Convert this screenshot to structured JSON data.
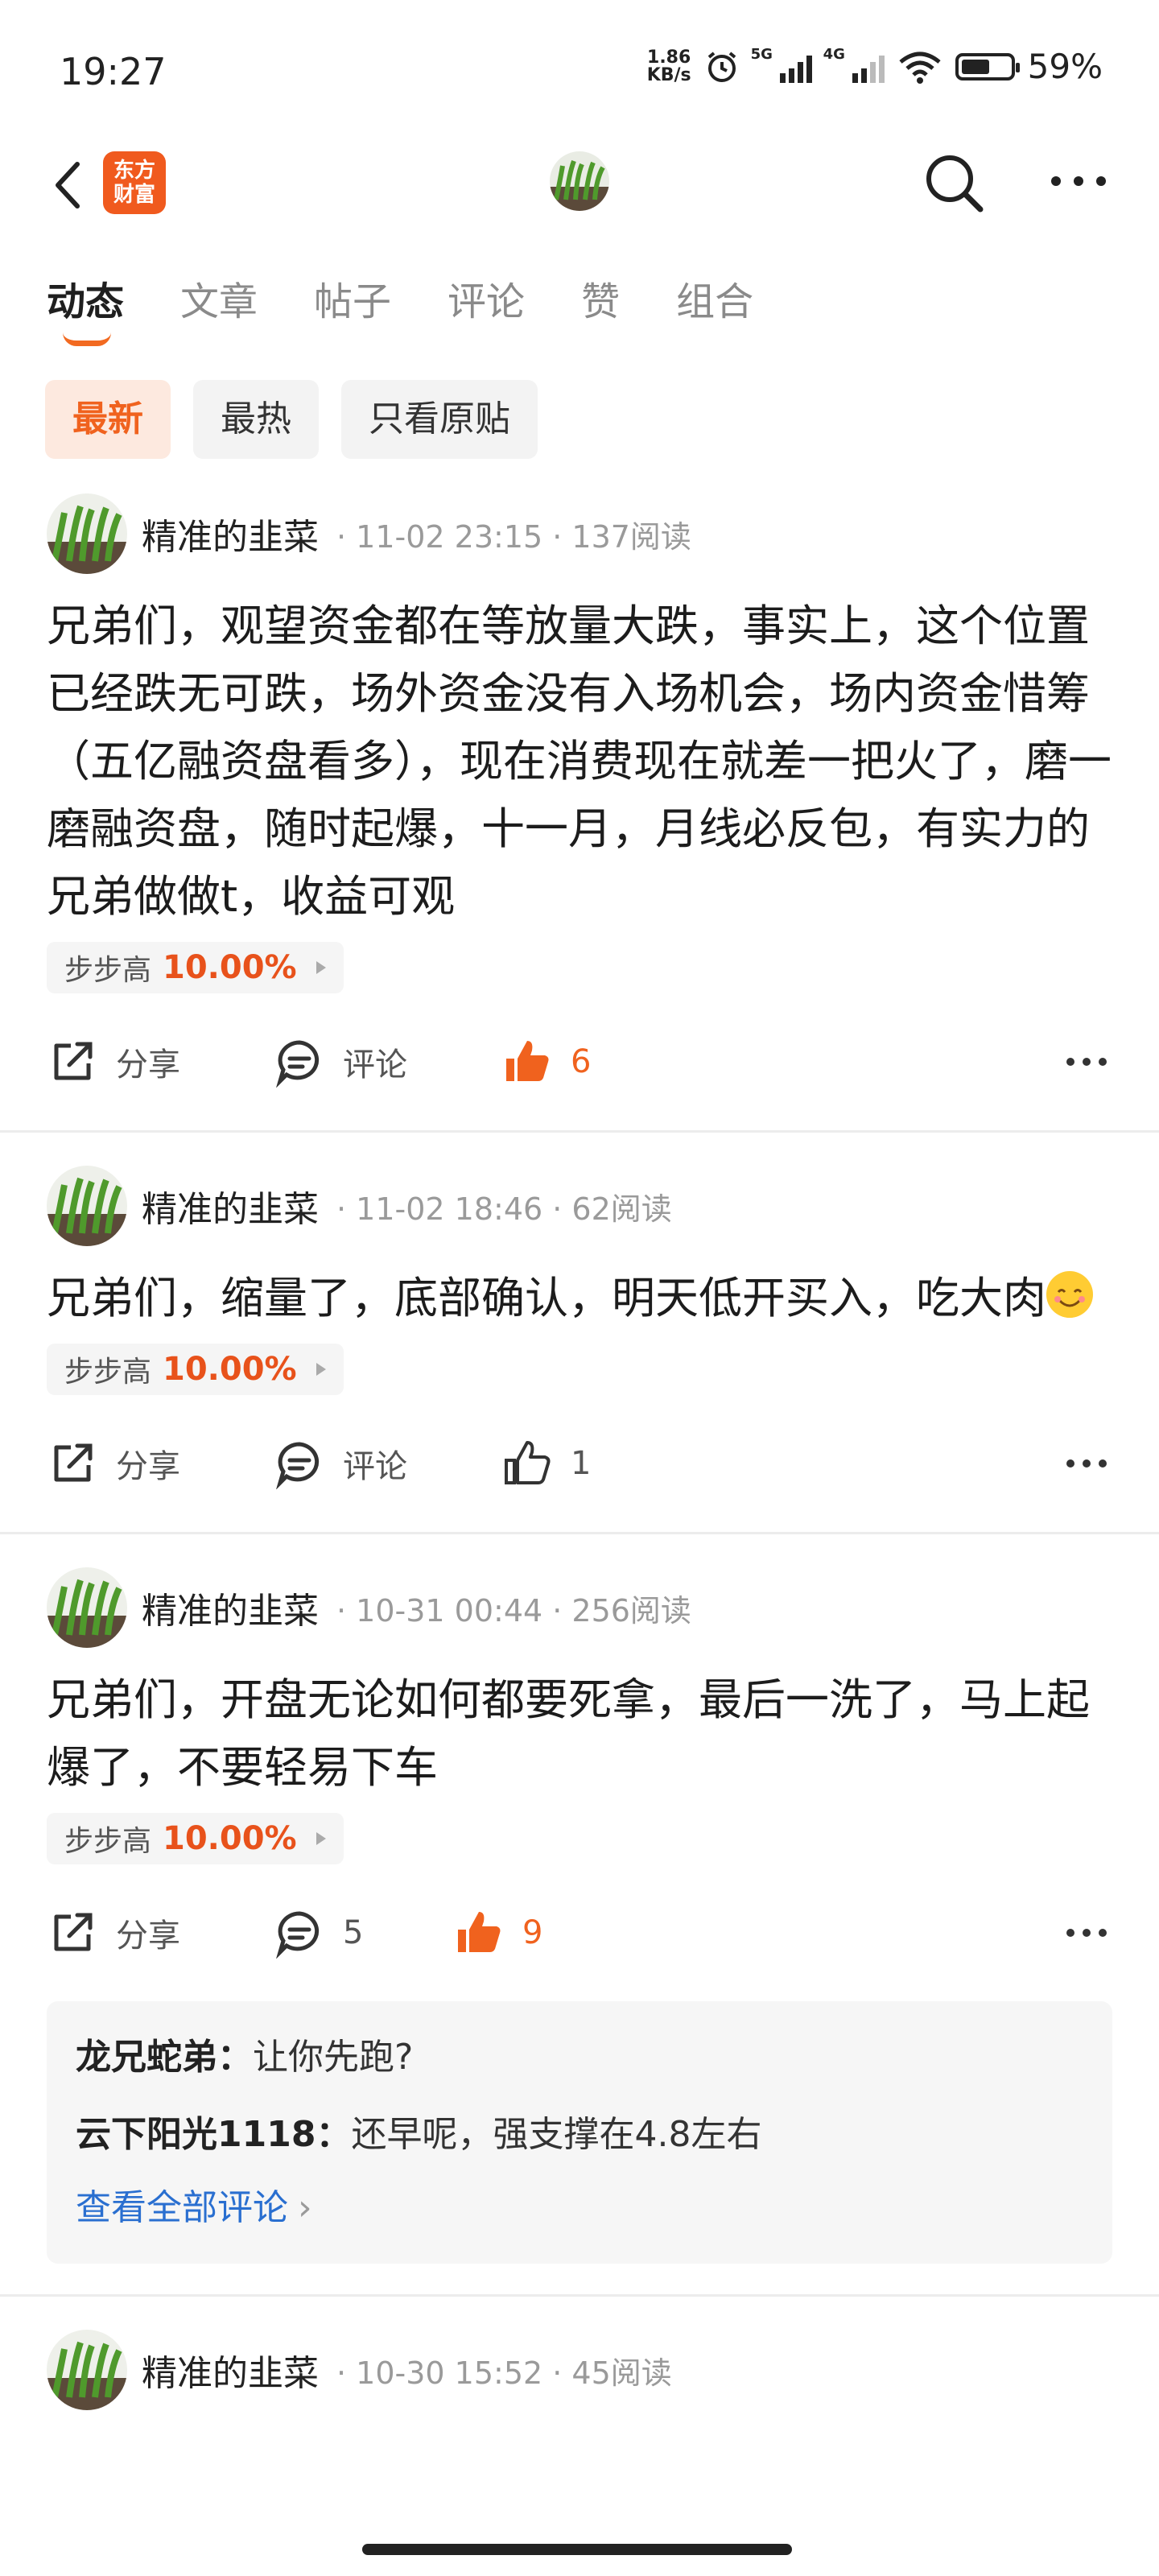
{
  "status_bar": {
    "time": "19:27",
    "net_speed_top": "1.86",
    "net_speed_unit": "KB/s",
    "signal_1": "5G",
    "signal_2": "4G",
    "battery": "59%"
  },
  "nav": {
    "logo_text_line1": "东方",
    "logo_text_line2": "财富",
    "icons": [
      "back-icon",
      "search-icon",
      "more-icon"
    ]
  },
  "tabs": [
    "动态",
    "文章",
    "帖子",
    "评论",
    "赞",
    "组合"
  ],
  "active_tab": "动态",
  "filters": [
    "最新",
    "最热",
    "只看原贴"
  ],
  "active_filter": "最新",
  "posts": [
    {
      "author": "精准的韭菜",
      "meta": "· 11-02 23:15 · 137阅读",
      "body": "兄弟们，观望资金都在等放量大跌，事实上，这个位置已经跌无可跌，场外资金没有入场机会，场内资金惜筹（五亿融资盘看多），现在消费现在就差一把火了，磨一磨融资盘，随时起爆，十一月，月线必反包，有实力的兄弟做做t，收益可观",
      "stock_name": "步步高",
      "stock_pct": "10.00%",
      "share_label": "分享",
      "comment_label": "评论",
      "like_count": "6",
      "liked": true
    },
    {
      "author": "精准的韭菜",
      "meta": "· 11-02 18:46 · 62阅读",
      "body": "兄弟们，缩量了，底部确认，明天低开买入，吃大肉",
      "emoji": "smile",
      "stock_name": "步步高",
      "stock_pct": "10.00%",
      "share_label": "分享",
      "comment_label": "评论",
      "like_count": "1",
      "liked": false
    },
    {
      "author": "精准的韭菜",
      "meta": "· 10-31 00:44 · 256阅读",
      "body": "兄弟们，开盘无论如何都要死拿，最后一洗了，马上起爆了，不要轻易下车",
      "stock_name": "步步高",
      "stock_pct": "10.00%",
      "share_label": "分享",
      "comment_label": "5",
      "like_count": "9",
      "liked": true,
      "comments": [
        {
          "user": "龙兄蛇弟：",
          "text": "让你先跑?"
        },
        {
          "user": "云下阳光1118：",
          "text": "还早呢，强支撑在4.8左右"
        }
      ],
      "view_all": "查看全部评论"
    },
    {
      "author": "精准的韭菜",
      "meta": "· 10-30 15:52 · 45阅读"
    }
  ],
  "colors": {
    "accent": "#f0621e",
    "link": "#2a6fd0"
  }
}
